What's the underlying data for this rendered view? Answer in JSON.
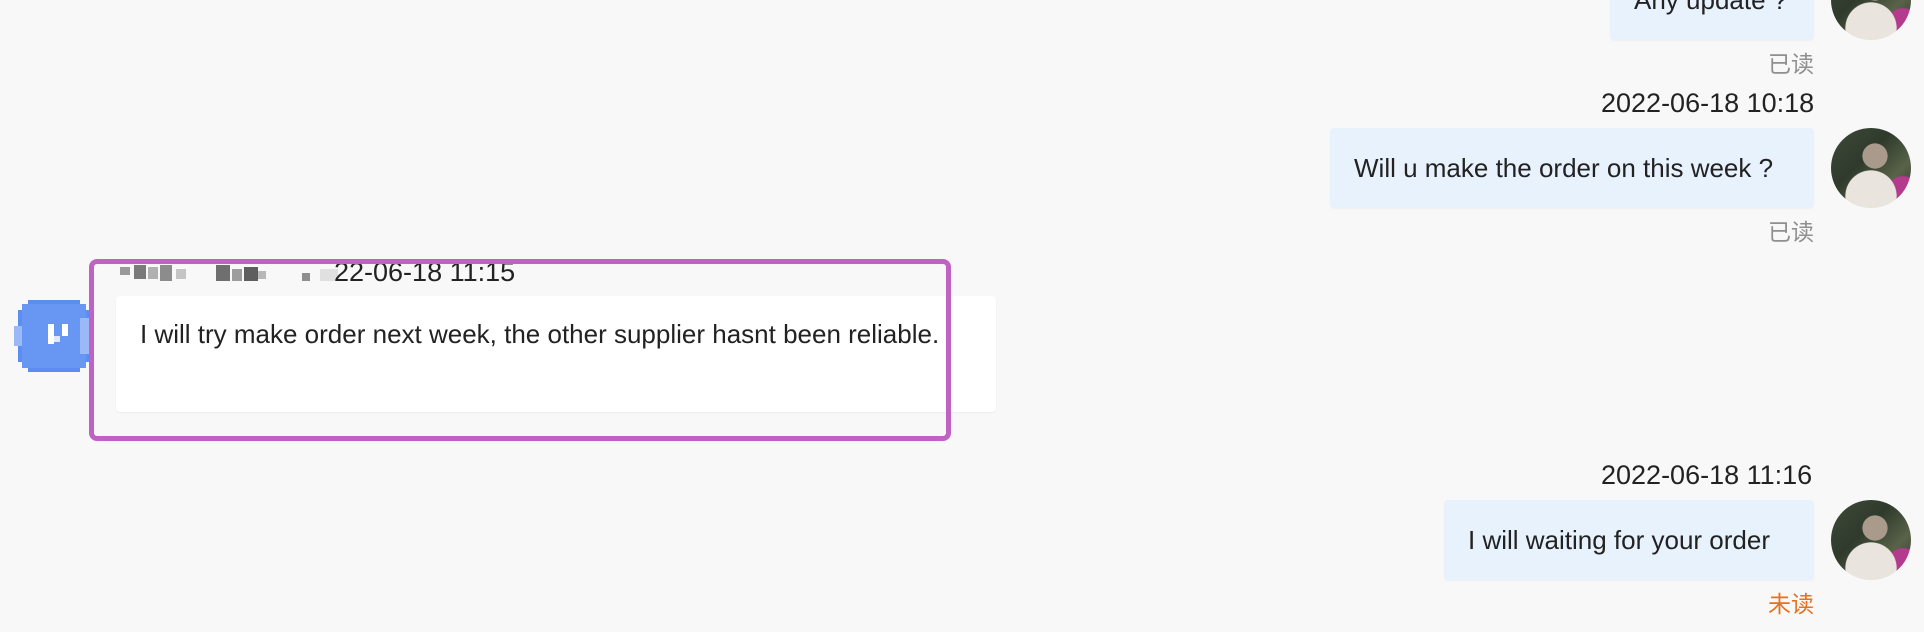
{
  "messages": [
    {
      "direction": "out",
      "text": "Any update ?",
      "status": "已读"
    },
    {
      "direction": "out",
      "timestamp": "2022-06-18 10:18",
      "text": "Will u make the order on this week ?",
      "status": "已读"
    },
    {
      "direction": "in",
      "timestamp_partial": "22-06-18 11:15",
      "text": "I will try make order next week, the other supplier hasnt been reliable."
    },
    {
      "direction": "out",
      "timestamp": "2022-06-18 11:16",
      "text": "I will waiting for your order",
      "status": "未读"
    }
  ],
  "colors": {
    "background": "#f8f8f8",
    "outgoing_bubble": "#e8f2fd",
    "incoming_bubble": "#ffffff",
    "read_status": "#8f8f8f",
    "unread_status": "#e8711f",
    "highlight": "#c062c4",
    "contact_avatar": "#5b8ef0"
  },
  "icons": {
    "self_avatar": "user-photo-avatar",
    "contact_avatar": "contact-avatar-pixelated"
  }
}
